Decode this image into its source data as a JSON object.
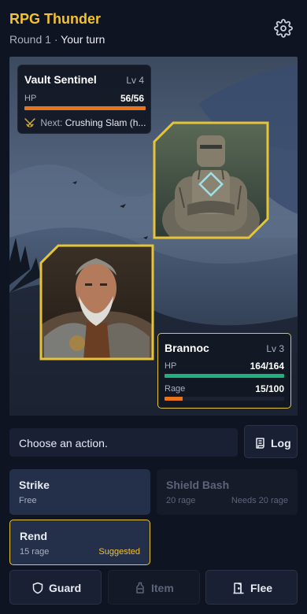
{
  "header": {
    "title": "RPG Thunder",
    "round": "Round 1",
    "separator": "·",
    "turn": "Your turn"
  },
  "enemy": {
    "name": "Vault Sentinel",
    "level": "Lv 4",
    "hp_label": "HP",
    "hp_text": "56/56",
    "hp_fraction": 1.0,
    "next_label": "Next:",
    "next_value": "Crushing Slam (h..."
  },
  "player": {
    "name": "Brannoc",
    "level": "Lv 3",
    "hp_label": "HP",
    "hp_text": "164/164",
    "hp_fraction": 1.0,
    "rage_label": "Rage",
    "rage_text": "15/100",
    "rage_fraction": 0.15
  },
  "prompt": "Choose an action.",
  "log_label": "Log",
  "skills": [
    {
      "name": "Strike",
      "cost": "Free",
      "note": ""
    },
    {
      "name": "Shield Bash",
      "cost": "20 rage",
      "note": "Needs 20 rage"
    },
    {
      "name": "Rend",
      "cost": "15 rage",
      "note": "Suggested"
    }
  ],
  "actions": {
    "guard": "Guard",
    "item": "Item",
    "flee": "Flee"
  },
  "colors": {
    "accent": "#f2c230",
    "enemy_hp": "#e8741c",
    "player_hp": "#1fb07d",
    "rage": "#e8741c",
    "highlight_border": "#e5c33a"
  },
  "icons": [
    "gear-icon",
    "swords-icon",
    "log-icon",
    "shield-icon",
    "potion-icon",
    "door-icon"
  ]
}
